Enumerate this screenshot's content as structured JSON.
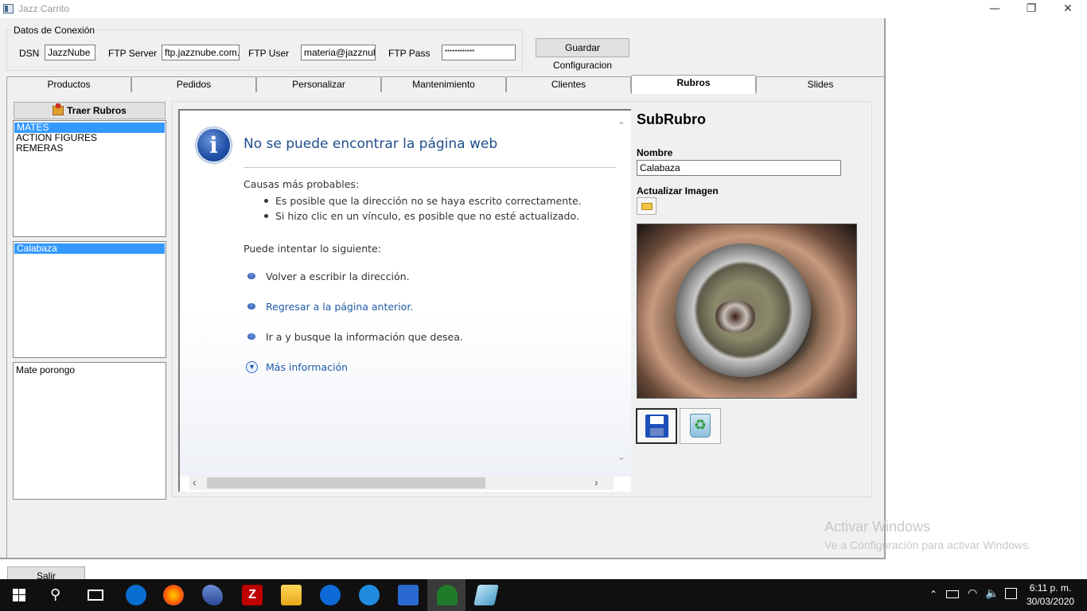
{
  "window": {
    "title": "Jazz Carrito",
    "minimize": "—",
    "maximize": "❐",
    "close": "✕"
  },
  "connection": {
    "group_title": "Datos de Conexión",
    "dsn_label": "DSN",
    "dsn_value": "JazzNube",
    "ftp_server_label": "FTP Server",
    "ftp_server_value": "ftp.jazznube.com.ar",
    "ftp_user_label": "FTP User",
    "ftp_user_value": "materia@jazznube",
    "ftp_pass_label": "FTP Pass",
    "ftp_pass_value": "************",
    "save_button": "Guardar Configuracion"
  },
  "tabs": [
    "Productos",
    "Pedidos",
    "Personalizar",
    "Mantenimiento",
    "Clientes",
    "Rubros",
    "Slides"
  ],
  "active_tab": "Rubros",
  "left": {
    "fetch_button": "Traer Rubros",
    "rubros": [
      "MATES",
      "ACTION FIGURES",
      "REMERAS"
    ],
    "subrubros": [
      "Calabaza"
    ],
    "products": [
      "Mate porongo"
    ]
  },
  "browser": {
    "title": "No se puede encontrar la página web",
    "causes_heading": "Causas más probables:",
    "causes": [
      "Es posible que la dirección no se haya escrito correctamente.",
      "Si hizo clic en un vínculo, es posible que no esté actualizado."
    ],
    "try_heading": "Puede intentar lo siguiente:",
    "actions": [
      "Volver a escribir la dirección.",
      "Regresar a la página anterior.",
      "Ir a  y busque la información que desea."
    ],
    "more_info": "Más información"
  },
  "subrubro": {
    "title": "SubRubro",
    "name_label": "Nombre",
    "name_value": "Calabaza",
    "update_image_label": "Actualizar Imagen"
  },
  "footer": {
    "exit_button": "Salir"
  },
  "watermark": {
    "line1": "Activar Windows",
    "line2": "Ve a Configuración para activar Windows."
  },
  "taskbar": {
    "time": "6:11 p. m.",
    "date": "30/03/2020"
  },
  "colors": {
    "selection": "#3399ff",
    "link": "#1f5aa6",
    "taskbar": "#101010"
  }
}
